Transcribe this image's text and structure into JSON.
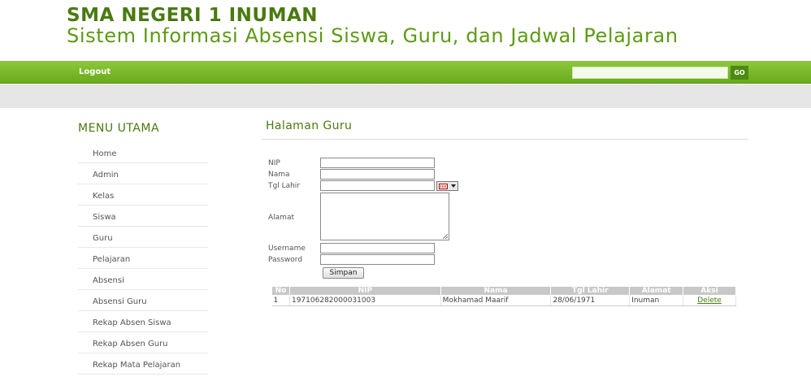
{
  "header": {
    "school_name": "SMA NEGERI 1 INUMAN",
    "system_title": "Sistem Informasi Absensi Siswa, Guru, dan Jadwal Pelajaran"
  },
  "navbar": {
    "logout_label": "Logout",
    "search": {
      "value": "",
      "placeholder": ""
    },
    "go_label": "GO"
  },
  "sidebar": {
    "title": "MENU UTAMA",
    "items": [
      {
        "label": "Home"
      },
      {
        "label": "Admin"
      },
      {
        "label": "Kelas"
      },
      {
        "label": "Siswa"
      },
      {
        "label": "Guru"
      },
      {
        "label": "Pelajaran"
      },
      {
        "label": "Absensi"
      },
      {
        "label": "Absensi Guru"
      },
      {
        "label": "Rekap Absen Siswa"
      },
      {
        "label": "Rekap Absen Guru"
      },
      {
        "label": "Rekap Mata Pelajaran"
      }
    ]
  },
  "main": {
    "title": "Halaman Guru",
    "form": {
      "nip_label": "NIP",
      "nama_label": "Nama",
      "tgl_lahir_label": "Tgl Lahir",
      "alamat_label": "Alamat",
      "username_label": "Username",
      "password_label": "Password",
      "calendar_icon": "calendar-icon",
      "submit_label": "Simpan"
    },
    "table": {
      "columns": [
        "No",
        "NIP",
        "Nama",
        "Tgl Lahir",
        "Alamat",
        "Aksi"
      ],
      "rows": [
        {
          "no": "1",
          "nip": "197106282000031003",
          "nama": "Mokhamad Maarif",
          "tgl_lahir": "28/06/1971",
          "alamat": "Inuman",
          "aksi": "Delete"
        }
      ]
    }
  },
  "colors": {
    "brand_green": "#4a7a10",
    "navbar_green": "#7ab82c",
    "table_header": "#c8c8c8"
  }
}
